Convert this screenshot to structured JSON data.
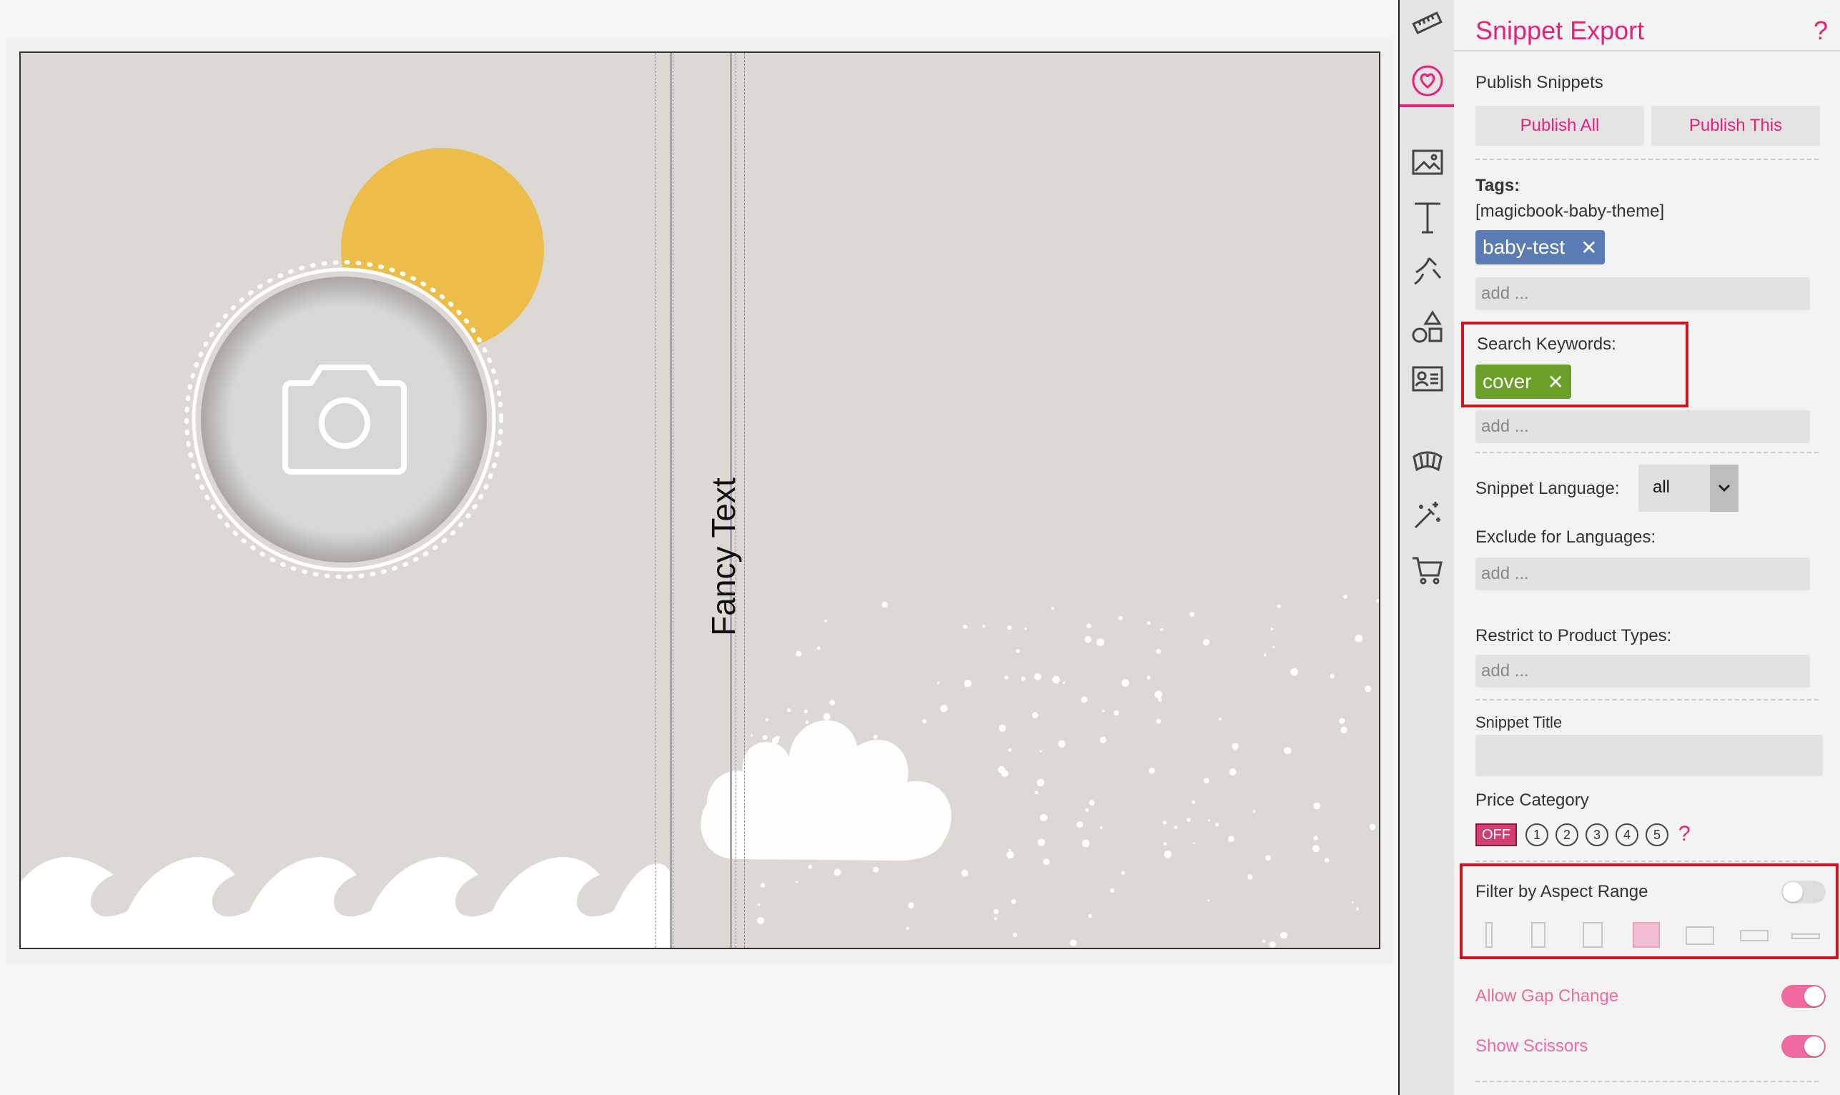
{
  "canvas": {
    "spine_text": "Fancy Text"
  },
  "tool_rail": {
    "icons": [
      "ruler-icon",
      "heart-icon",
      "image-icon",
      "text-icon",
      "clipart-icon",
      "shapes-icon",
      "contact-card-icon",
      "book-icon",
      "magic-wand-icon",
      "cart-icon"
    ],
    "active_icon": "heart-icon",
    "accent_color": "#e8207a"
  },
  "panel": {
    "title": "Snippet Export",
    "help_glyph": "?",
    "publish_label": "Publish Snippets",
    "publish_all": "Publish All",
    "publish_this": "Publish This",
    "tags_label": "Tags:",
    "tags_theme": "[magicbook-baby-theme]",
    "tag_chip": "baby-test",
    "tag_chip_color": "#5b7bb5",
    "add_placeholder": "add ...",
    "search_keywords_label": "Search Keywords:",
    "keyword_chip": "cover",
    "keyword_chip_color": "#6aa02a",
    "snippet_language_label": "Snippet Language:",
    "snippet_language_value": "all",
    "exclude_languages_label": "Exclude for Languages:",
    "restrict_product_label": "Restrict to Product Types:",
    "snippet_title_label": "Snippet Title",
    "snippet_title_value": "",
    "price_category_label": "Price Category",
    "price_off": "OFF",
    "price_levels": [
      "1",
      "2",
      "3",
      "4",
      "5"
    ],
    "filter_aspect_label": "Filter by Aspect Range",
    "filter_aspect_enabled": false,
    "allow_gap_label": "Allow Gap Change",
    "allow_gap_enabled": true,
    "show_scissors_label": "Show Scissors",
    "show_scissors_enabled": true
  }
}
